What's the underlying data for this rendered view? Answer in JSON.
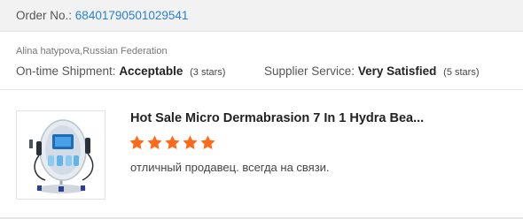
{
  "order": {
    "label": "Order No.:",
    "number": "68401790501029541"
  },
  "buyer": {
    "name_country": "Alina hatypova,Russian Federation"
  },
  "ratings": {
    "shipment": {
      "label": "On-time Shipment:",
      "value": "Acceptable",
      "count": "(3 stars)",
      "stars": 3
    },
    "supplier": {
      "label": "Supplier Service:",
      "value": "Very Satisfied",
      "count": "(5 stars)",
      "stars": 5
    }
  },
  "product": {
    "title": "Hot Sale Micro Dermabrasion 7 In 1 Hydra Bea...",
    "rating": 5,
    "review": "отличный продавец. всегда на связи."
  },
  "colors": {
    "link": "#2a7fd4",
    "star": "#ff6a1a"
  }
}
